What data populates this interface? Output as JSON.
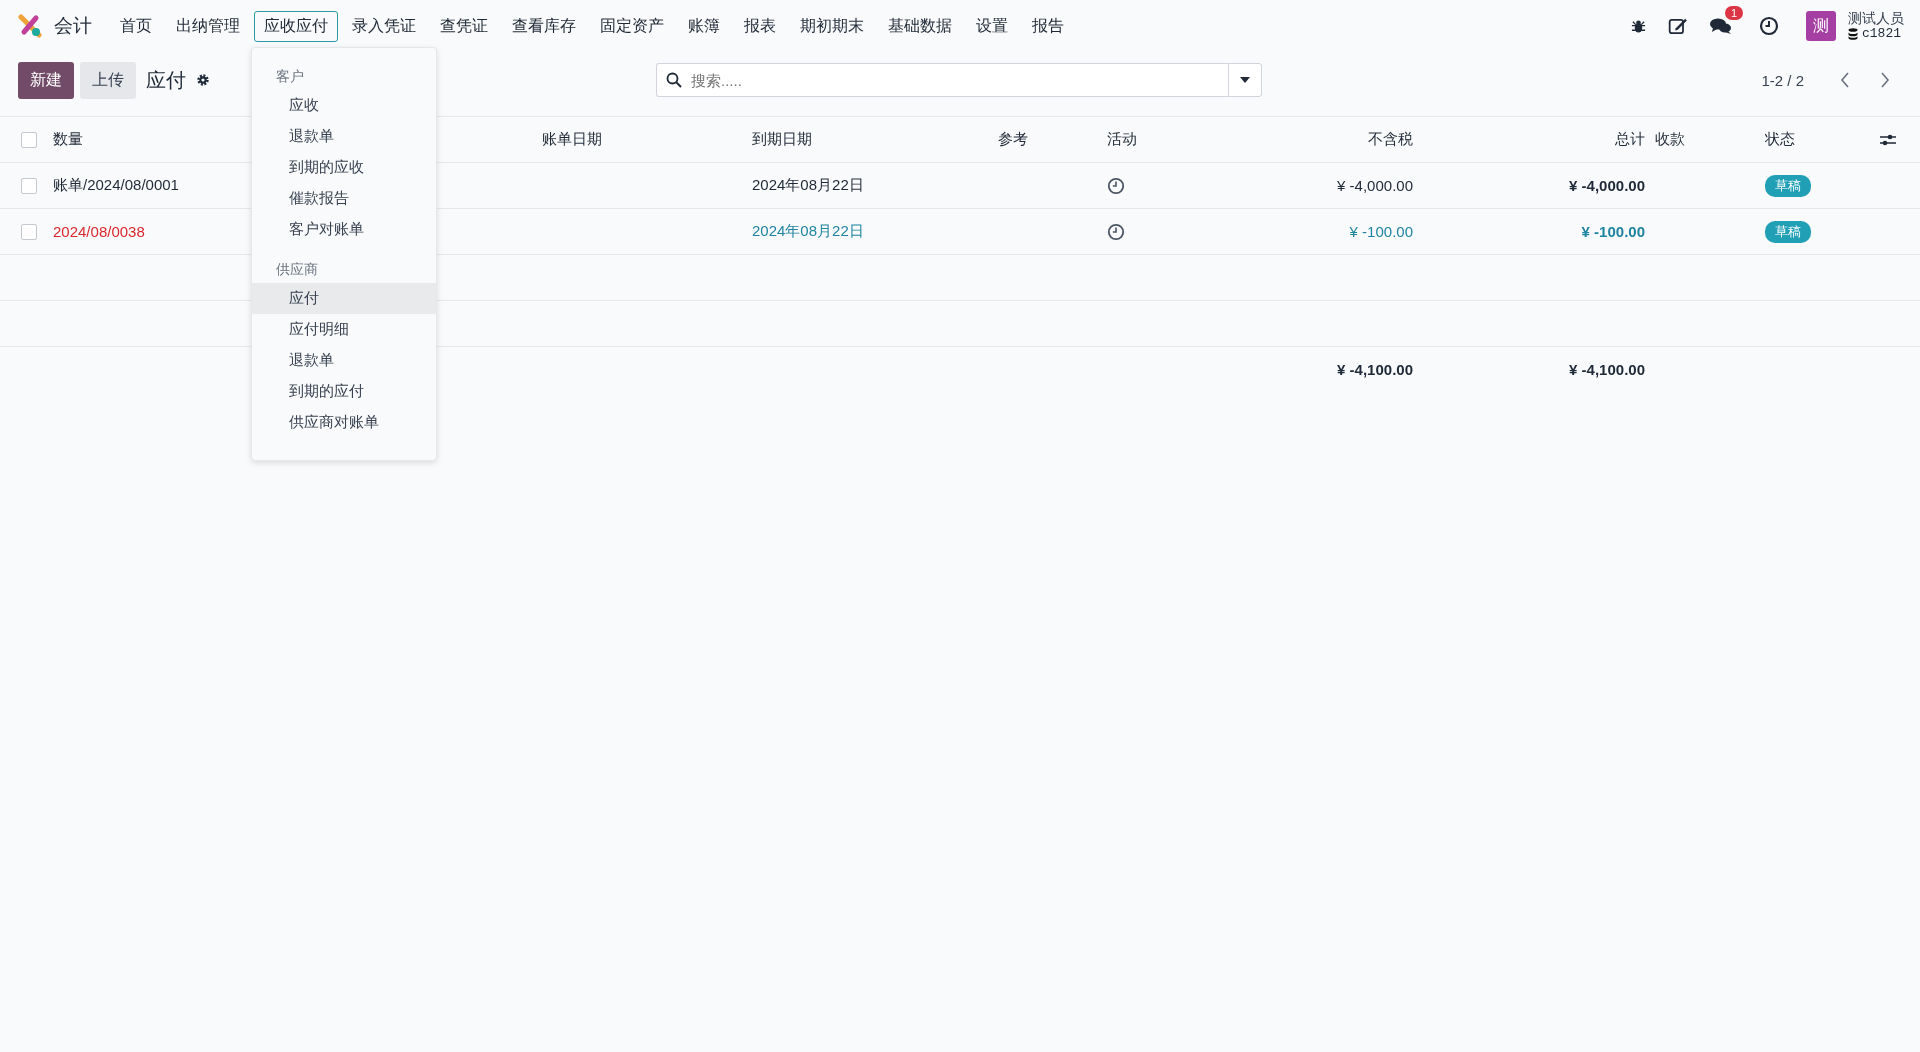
{
  "app": {
    "name": "会计"
  },
  "menu": [
    {
      "label": "首页",
      "selected": false
    },
    {
      "label": "出纳管理",
      "selected": false
    },
    {
      "label": "应收应付",
      "selected": true
    },
    {
      "label": "录入凭证",
      "selected": false
    },
    {
      "label": "查凭证",
      "selected": false
    },
    {
      "label": "查看库存",
      "selected": false
    },
    {
      "label": "固定资产",
      "selected": false
    },
    {
      "label": "账簿",
      "selected": false
    },
    {
      "label": "报表",
      "selected": false
    },
    {
      "label": "期初期末",
      "selected": false
    },
    {
      "label": "基础数据",
      "selected": false
    },
    {
      "label": "设置",
      "selected": false
    },
    {
      "label": "报告",
      "selected": false
    }
  ],
  "dropdown": {
    "groups": [
      {
        "title": "客户",
        "items": [
          {
            "label": "应收",
            "selected": false
          },
          {
            "label": "退款单",
            "selected": false
          },
          {
            "label": "到期的应收",
            "selected": false
          },
          {
            "label": "催款报告",
            "selected": false
          },
          {
            "label": "客户对账单",
            "selected": false
          }
        ]
      },
      {
        "title": "供应商",
        "items": [
          {
            "label": "应付",
            "selected": true
          },
          {
            "label": "应付明细",
            "selected": false
          },
          {
            "label": "退款单",
            "selected": false
          },
          {
            "label": "到期的应付",
            "selected": false
          },
          {
            "label": "供应商对账单",
            "selected": false
          }
        ]
      }
    ]
  },
  "systray": {
    "message_count": "1",
    "avatar_letter": "测",
    "user_name": "测试人员",
    "database": "c1821"
  },
  "toolbar": {
    "new_button": "新建",
    "upload_button": "上传",
    "title": "应付",
    "search": {
      "placeholder": "搜索....."
    },
    "pager": "1-2 / 2"
  },
  "table": {
    "all_checked": false,
    "columns": [
      "数量",
      "账单日期",
      "到期日期",
      "参考",
      "活动",
      "不含税",
      "总计",
      "收款",
      "状态"
    ],
    "rows": [
      {
        "number": "账单/2024/08/0001",
        "due_date": "2024年08月22日",
        "untaxed": "¥ -4,000.00",
        "total": "¥ -4,000.00",
        "status": "草稿",
        "overdue": false,
        "checked": false
      },
      {
        "number": "2024/08/0038",
        "due_date": "2024年08月22日",
        "untaxed": "¥ -100.00",
        "total": "¥ -100.00",
        "status": "草稿",
        "overdue": true,
        "checked": false
      }
    ],
    "totals": {
      "untaxed": "¥ -4,100.00",
      "total": "¥ -4,100.00"
    }
  }
}
